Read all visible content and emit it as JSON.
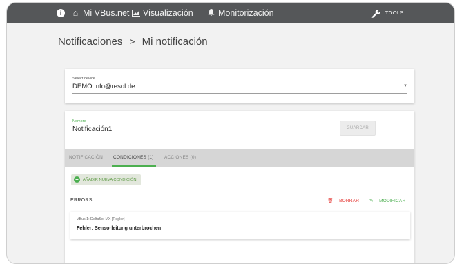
{
  "nav": {
    "items": [
      {
        "label": "Mi VBus.net",
        "icon": "home-icon"
      },
      {
        "label": "Visualización",
        "icon": "chart-icon"
      },
      {
        "label": "Monitorización",
        "icon": "bell-icon"
      }
    ],
    "tools_label": "TOOLS"
  },
  "breadcrumb": {
    "parent": "Notificaciones",
    "separator": ">",
    "current": "Mi notificación"
  },
  "device": {
    "label": "Select device",
    "value": "DEMO Info@resol.de"
  },
  "form": {
    "name_label": "Nombre",
    "name_value": "Notificación1",
    "save_label": "GUARDAR"
  },
  "tabs": [
    {
      "label": "NOTIFICACIÓN"
    },
    {
      "label": "CONDICIONES (1)"
    },
    {
      "label": "ACCIONES (0)"
    }
  ],
  "conditions": {
    "add_label": "AÑADIR NUEVA CONDICIÓN",
    "group_title": "ERRORS",
    "delete_label": "BORRAR",
    "modify_label": "MODIFICAR",
    "item": {
      "device": "VBus 1: DeltaSol MX [Regler]",
      "text": "Fehler: Sensorleitung unterbrochen"
    }
  },
  "colors": {
    "topbar": "#555759",
    "accent": "#4caf50",
    "danger": "#e53935",
    "tabbar": "#d6d6d6"
  }
}
